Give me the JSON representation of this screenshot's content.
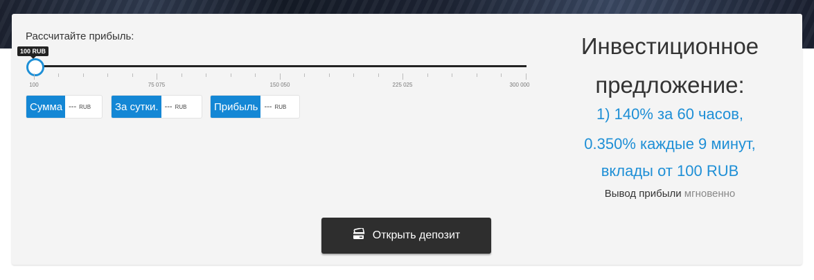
{
  "calculator": {
    "label": "Рассчитайте прибыль:",
    "slider": {
      "tooltip": "100 RUB",
      "value": 100,
      "min": 100,
      "max": 300000,
      "tick_labels": [
        "100",
        "75 075",
        "150 050",
        "225 025",
        "300 000"
      ]
    },
    "boxes": [
      {
        "label": "Сумма",
        "value": "---",
        "unit": "RUB"
      },
      {
        "label": "За сутки.",
        "value": "---",
        "unit": "RUB"
      },
      {
        "label": "Прибыль",
        "value": "---",
        "unit": "RUB"
      }
    ]
  },
  "offer": {
    "title_line1": "Инвестиционное",
    "title_line2": "предложение:",
    "lines": [
      "1) 140% за 60 часов,",
      "0.350% каждые 9 минут,",
      "вклады от 100 RUB"
    ],
    "withdraw_label": "Вывод прибыли",
    "withdraw_value": "мгновенно"
  },
  "button": {
    "label": "Открыть депозит",
    "icon": "credit-card-icon"
  },
  "colors": {
    "accent": "#1487d5",
    "button_bg": "#2e2e2e",
    "panel_bg": "#f4f4f4"
  }
}
